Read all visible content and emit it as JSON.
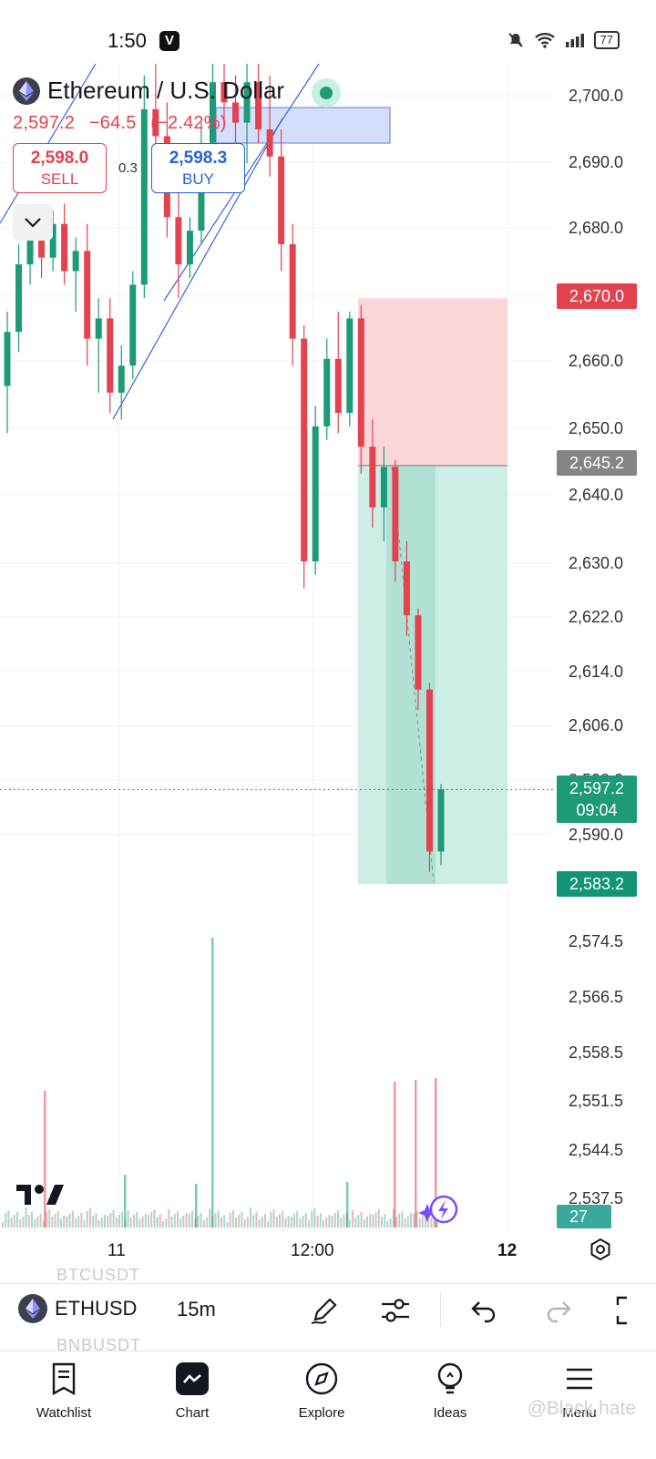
{
  "status_bar": {
    "time": "1:50",
    "app_badge": "V",
    "battery": "77"
  },
  "header": {
    "title": "Ethereum / U.S. Dollar",
    "last_price": "2,597.2",
    "change": "−64.5",
    "change_pct": "(−2.42%)",
    "sell_price": "2,598.0",
    "sell_label": "SELL",
    "buy_price": "2,598.3",
    "buy_label": "BUY",
    "spread": "0.3"
  },
  "colors": {
    "up": "#1d9b76",
    "down": "#e2434f",
    "buy": "#2a62d6",
    "stop_zone": "#fdd6da",
    "target_zone": "#cdeee6"
  },
  "price_axis": {
    "labels": [
      "2,700.0",
      "2,690.0",
      "2,680.0",
      "2,670.0",
      "2,660.0",
      "2,650.0",
      "2,645.2",
      "2,640.0",
      "2,630.0",
      "2,622.0",
      "2,614.0",
      "2,606.0",
      "2,598.0",
      "2,597.2",
      "2,590.0",
      "2,583.2",
      "2,574.5",
      "2,566.5",
      "2,558.5",
      "2,551.5",
      "2,544.5",
      "2,537.5"
    ],
    "stop_tag": "2,670.0",
    "entry_tag": "2,645.2",
    "current_tag": "2,597.2",
    "countdown": "09:04",
    "target_tag": "2,583.2",
    "volume_tag": "27"
  },
  "time_axis": {
    "labels": [
      "11",
      "12:00",
      "12"
    ]
  },
  "toolbar": {
    "symbol": "ETHUSD",
    "interval": "15m",
    "ghost_above": "BTCUSDT",
    "ghost_below": "BNBUSDT",
    "icons": [
      "draw-pen-icon",
      "indicators-icon",
      "undo-icon",
      "redo-icon",
      "fullscreen-icon"
    ]
  },
  "nav": {
    "items": [
      {
        "label": "Watchlist",
        "icon": "watchlist-icon"
      },
      {
        "label": "Chart",
        "icon": "chart-icon"
      },
      {
        "label": "Explore",
        "icon": "compass-icon"
      },
      {
        "label": "Ideas",
        "icon": "lightbulb-icon"
      },
      {
        "label": "Menu",
        "icon": "menu-icon"
      }
    ]
  },
  "watermark": "@Black.hate",
  "chart_data": {
    "type": "candlestick",
    "symbol": "ETHUSD",
    "interval": "15m",
    "y_range": [
      2583.2,
      2700.0
    ],
    "position": {
      "entry": 2645.2,
      "stop": 2670.0,
      "target": 2583.2
    },
    "candles": [
      {
        "o": 2657,
        "h": 2668,
        "l": 2650,
        "c": 2665
      },
      {
        "o": 2665,
        "h": 2678,
        "l": 2662,
        "c": 2675
      },
      {
        "o": 2675,
        "h": 2681,
        "l": 2672,
        "c": 2679
      },
      {
        "o": 2679,
        "h": 2682,
        "l": 2673,
        "c": 2676
      },
      {
        "o": 2676,
        "h": 2683,
        "l": 2674,
        "c": 2681
      },
      {
        "o": 2681,
        "h": 2684,
        "l": 2672,
        "c": 2674
      },
      {
        "o": 2674,
        "h": 2679,
        "l": 2668,
        "c": 2677
      },
      {
        "o": 2677,
        "h": 2681,
        "l": 2660,
        "c": 2664
      },
      {
        "o": 2664,
        "h": 2670,
        "l": 2656,
        "c": 2667
      },
      {
        "o": 2667,
        "h": 2670,
        "l": 2653,
        "c": 2656
      },
      {
        "o": 2656,
        "h": 2663,
        "l": 2652,
        "c": 2660
      },
      {
        "o": 2660,
        "h": 2674,
        "l": 2658,
        "c": 2672
      },
      {
        "o": 2672,
        "h": 2703,
        "l": 2670,
        "c": 2698
      },
      {
        "o": 2698,
        "h": 2705,
        "l": 2690,
        "c": 2694
      },
      {
        "o": 2694,
        "h": 2699,
        "l": 2679,
        "c": 2682
      },
      {
        "o": 2682,
        "h": 2688,
        "l": 2670,
        "c": 2675
      },
      {
        "o": 2675,
        "h": 2682,
        "l": 2673,
        "c": 2680
      },
      {
        "o": 2680,
        "h": 2696,
        "l": 2678,
        "c": 2693
      },
      {
        "o": 2693,
        "h": 2705,
        "l": 2690,
        "c": 2702
      },
      {
        "o": 2702,
        "h": 2706,
        "l": 2696,
        "c": 2699
      },
      {
        "o": 2699,
        "h": 2703,
        "l": 2693,
        "c": 2696
      },
      {
        "o": 2696,
        "h": 2705,
        "l": 2690,
        "c": 2702
      },
      {
        "o": 2702,
        "h": 2706,
        "l": 2693,
        "c": 2695
      },
      {
        "o": 2695,
        "h": 2703,
        "l": 2688,
        "c": 2691
      },
      {
        "o": 2691,
        "h": 2695,
        "l": 2674,
        "c": 2678
      },
      {
        "o": 2678,
        "h": 2681,
        "l": 2660,
        "c": 2664
      },
      {
        "o": 2664,
        "h": 2666,
        "l": 2627,
        "c": 2631
      },
      {
        "o": 2631,
        "h": 2654,
        "l": 2629,
        "c": 2651
      },
      {
        "o": 2651,
        "h": 2664,
        "l": 2649,
        "c": 2661
      },
      {
        "o": 2661,
        "h": 2668,
        "l": 2650,
        "c": 2653
      },
      {
        "o": 2653,
        "h": 2668,
        "l": 2651,
        "c": 2667
      },
      {
        "o": 2667,
        "h": 2669,
        "l": 2644,
        "c": 2648
      },
      {
        "o": 2648,
        "h": 2652,
        "l": 2636,
        "c": 2639
      },
      {
        "o": 2639,
        "h": 2648,
        "l": 2634,
        "c": 2645
      },
      {
        "o": 2645,
        "h": 2646,
        "l": 2628,
        "c": 2631
      },
      {
        "o": 2631,
        "h": 2634,
        "l": 2620,
        "c": 2623
      },
      {
        "o": 2623,
        "h": 2624,
        "l": 2609,
        "c": 2612
      },
      {
        "o": 2612,
        "h": 2613,
        "l": 2585,
        "c": 2588
      },
      {
        "o": 2588,
        "h": 2598,
        "l": 2586,
        "c": 2597.2
      }
    ]
  }
}
